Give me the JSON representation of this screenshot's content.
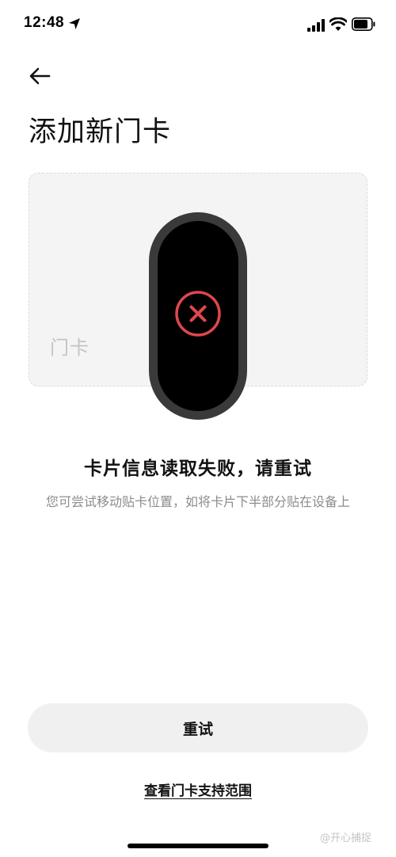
{
  "status_bar": {
    "time": "12:48",
    "icons": [
      "location-arrow-icon",
      "cellular-signal-icon",
      "wifi-icon",
      "battery-icon"
    ]
  },
  "header": {
    "back_icon": "back-arrow-icon",
    "title": "添加新门卡"
  },
  "card": {
    "label": "门卡"
  },
  "band": {
    "status_icon": "error-x-icon",
    "status_color": "#e0474c"
  },
  "message": {
    "title": "卡片信息读取失败，请重试",
    "description": "您可尝试移动贴卡位置，如将卡片下半部分贴在设备上"
  },
  "actions": {
    "retry_label": "重试",
    "support_link": "查看门卡支持范围"
  },
  "watermark": "@开心捕捉"
}
